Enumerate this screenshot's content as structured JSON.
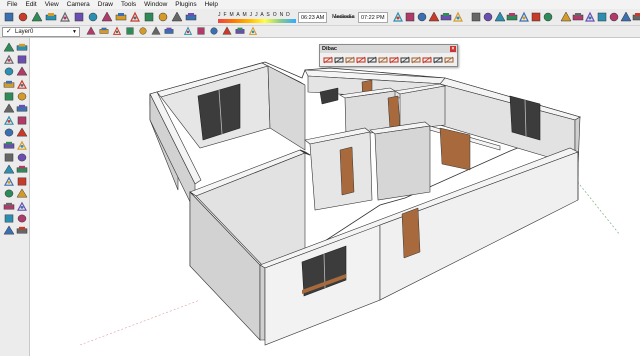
{
  "menu": {
    "items": [
      "File",
      "Edit",
      "View",
      "Camera",
      "Draw",
      "Tools",
      "Window",
      "Plugins",
      "Help"
    ]
  },
  "shadow_settings": {
    "months": "J F M A M J J A S O N D",
    "time_start": "06:23 AM",
    "time_mid": "Mediodía",
    "time_end": "07:22 PM"
  },
  "layers": {
    "current": "Layer0"
  },
  "dibac": {
    "title": "Dibac",
    "close": "×"
  },
  "icons": {
    "toolbar1": [
      "new-icon",
      "open-icon",
      "save-icon",
      "cut-icon",
      "copy-icon",
      "paste-icon",
      "erase-icon",
      "undo-icon",
      "redo-icon",
      "print-icon",
      "model-info-icon",
      "make-component-icon",
      "select-icon",
      "paint-icon",
      "eraser-icon",
      "rectangle-icon",
      "line-icon",
      "circle-icon",
      "arc-icon",
      "polygon-icon",
      "freehand-icon",
      "move-icon",
      "push-pull-icon",
      "rotate-icon",
      "follow-me-icon",
      "scale-icon",
      "offset-icon",
      "tape-icon",
      "dimension-icon",
      "protractor-icon",
      "text-icon",
      "axes-icon",
      "3d-text-icon",
      "orbit-icon",
      "pan-icon",
      "zoom-icon",
      "zoom-window-icon",
      "zoom-extents-icon",
      "previous-view-icon",
      "next-view-icon",
      "position-camera-icon",
      "walk-icon",
      "look-around-icon",
      "section-plane-icon",
      "get-models-icon",
      "share-model-icon",
      "share-component-icon",
      "google-earth-icon",
      "3d-warehouse-icon"
    ],
    "toolbar2": [
      "layer-manager-icon",
      "iso-view-icon",
      "top-view-icon",
      "front-view-icon",
      "right-view-icon",
      "back-view-icon",
      "left-view-icon",
      "xray-icon",
      "wireframe-icon",
      "hidden-line-icon",
      "shaded-icon",
      "shaded-texture-icon",
      "monochrome-icon"
    ],
    "palette": [
      "select-tool-icon",
      "make-component-tool-icon",
      "paint-bucket-icon",
      "eraser-tool-icon",
      "rectangle-tool-icon",
      "line-tool-icon",
      "circle-tool-icon",
      "arc-tool-icon",
      "polygon-tool-icon",
      "freehand-tool-icon",
      "move-tool-icon",
      "push-pull-tool-icon",
      "rotate-tool-icon",
      "follow-me-tool-icon",
      "scale-tool-icon",
      "offset-tool-icon",
      "tape-measure-icon",
      "dimension-tool-icon",
      "protractor-tool-icon",
      "text-tool-icon",
      "axes-tool-icon",
      "3d-text-tool-icon",
      "orbit-tool-icon",
      "pan-tool-icon",
      "zoom-tool-icon",
      "zoom-window-tool-icon",
      "zoom-extents-tool-icon",
      "previous-tool-icon",
      "position-camera-tool-icon",
      "walk-tool-icon",
      "look-around-tool-icon",
      "section-plane-tool-icon"
    ],
    "dibac": [
      "wall-icon",
      "door-icon",
      "window-icon",
      "stair-icon",
      "dimension-icon",
      "measure-icon",
      "furniture-icon",
      "join-icon",
      "materials-icon",
      "extend-icon",
      "settings-icon",
      "gear-icon"
    ]
  },
  "colors": {
    "wall_top": "#f5f5f5",
    "wall_side": "#d4d4d4",
    "floor": "#ffffff",
    "door": "#a86a3c",
    "window_glass": "#4a4a4a",
    "accent_red": "#c83a2a"
  }
}
